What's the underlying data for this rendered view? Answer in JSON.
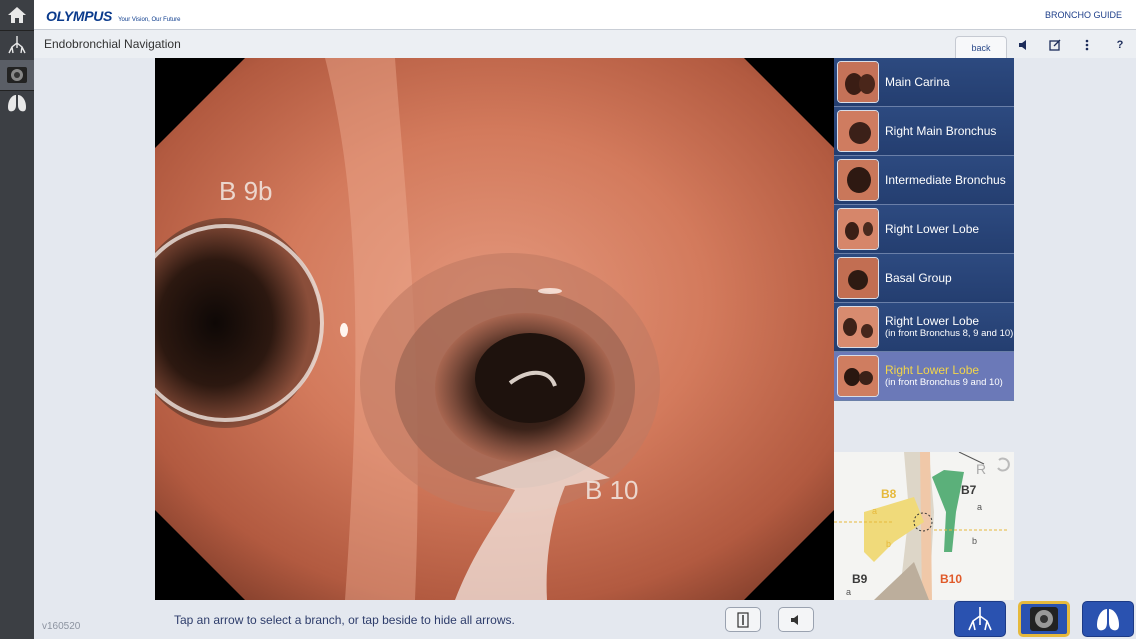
{
  "header": {
    "brand_name": "OLYMPUS",
    "brand_tagline": "Your Vision, Our Future",
    "app_name": "BRONCHO GUIDE"
  },
  "titlebar": {
    "title": "Endobronchial Navigation",
    "back_label": "back",
    "icons": [
      "speaker-icon",
      "edit-icon",
      "more-icon",
      "help-icon"
    ],
    "help_label": "?"
  },
  "rail": {
    "items": [
      "home-icon",
      "bronchial-tree-icon",
      "endoscope-view-icon",
      "lungs-icon"
    ],
    "active_index": 2
  },
  "scope": {
    "labels": [
      {
        "text": "B 9b"
      },
      {
        "text": "B 10"
      }
    ]
  },
  "navlist": {
    "items": [
      {
        "label": "Main Carina",
        "sub": ""
      },
      {
        "label": "Right Main Bronchus",
        "sub": ""
      },
      {
        "label": "Intermediate Bronchus",
        "sub": ""
      },
      {
        "label": "Right Lower Lobe",
        "sub": ""
      },
      {
        "label": "Basal Group",
        "sub": ""
      },
      {
        "label": "Right Lower Lobe",
        "sub": "(in front Bronchus 8, 9 and 10)"
      },
      {
        "label": "Right Lower Lobe",
        "sub": "(in front Bronchus 9 and 10)"
      }
    ],
    "selected_index": 6
  },
  "diagram": {
    "side_label": "R",
    "labels": [
      "B8",
      "B7",
      "B9",
      "B10",
      "a",
      "b",
      "a",
      "b",
      "a"
    ]
  },
  "footer": {
    "version": "v160520",
    "hint": "Tap an arrow to select a branch, or tap beside to hide all arrows.",
    "controls": [
      "notes-icon",
      "sound-icon"
    ],
    "views": [
      "bronchial-tree-view-icon",
      "endoscope-view-icon",
      "lungs-view-icon"
    ],
    "active_view_index": 1
  },
  "colors": {
    "brand": "#0a3a8c",
    "nav_bg": "#2d4a80",
    "nav_selected_bg": "#6b79b8",
    "nav_selected_text": "#f2d54a",
    "active_view_border": "#e6b93c"
  }
}
